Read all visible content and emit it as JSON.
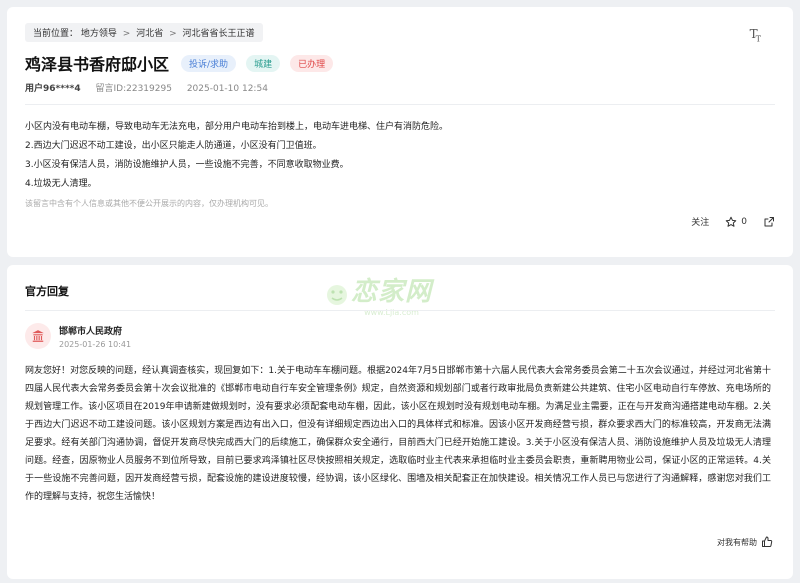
{
  "breadcrumb": {
    "prefix": "当前位置：",
    "items": [
      "地方领导",
      "河北省",
      "河北省省长王正谱"
    ],
    "separator": ">"
  },
  "font_size_control": {
    "label": "T",
    "sub": "T"
  },
  "post": {
    "title": "鸡泽县书香府邸小区",
    "tags": {
      "type": "投诉/求助",
      "domain": "城建",
      "status": "已办理"
    },
    "user": "用户96****4",
    "message_id": "留言ID:22319295",
    "date": "2025-01-10 12:54",
    "body": [
      "小区内没有电动车棚，导致电动车无法充电，部分用户电动车抬到楼上，电动车进电梯、住户有消防危险。",
      "2.西边大门迟迟不动工建设，出小区只能走人防通道，小区没有门卫值班。",
      "3.小区没有保洁人员，消防设施维护人员，一些设施不完善，不同意收取物业费。",
      "4.垃圾无人清理。"
    ],
    "disclaimer": "该留言中含有个人信息或其他不便公开展示的内容，仅办理机构可见。",
    "actions": {
      "follow": "关注",
      "favorites": "0"
    }
  },
  "watermark": {
    "text": "恋家网",
    "sub": "www.Ljia.com"
  },
  "reply": {
    "section_title": "官方回复",
    "org_name": "邯郸市人民政府",
    "org_time": "2025-01-26 10:41",
    "text": "网友您好！对您反映的问题，经认真调查核实，现回复如下：1.关于电动车车棚问题。根据2024年7月5日邯郸市第十六届人民代表大会常务委员会第二十五次会议通过，并经过河北省第十四届人民代表大会常务委员会第十次会议批准的《邯郸市电动自行车安全管理条例》规定，自然资源和规划部门或者行政审批局负责新建公共建筑、住宅小区电动自行车停放、充电场所的规划管理工作。该小区项目在2019年申请新建做规划时，没有要求必须配套电动车棚，因此，该小区在规划时没有规划电动车棚。为满足业主需要，正在与开发商沟通搭建电动车棚。2.关于西边大门迟迟不动工建设问题。该小区规划方案是西边有出入口，但没有详细规定西边出入口的具体样式和标准。因该小区开发商经营亏损，群众要求西大门的标准较高，开发商无法满足要求。经有关部门沟通协调，督促开发商尽快完成西大门的后续施工，确保群众安全通行，目前西大门已经开始施工建设。3.关于小区没有保洁人员、消防设施维护人员及垃圾无人清理问题。经查，因原物业人员服务不到位所导致，目前已要求鸡泽镇社区尽快按照相关规定，选取临时业主代表来承担临时业主委员会职责，重新聘用物业公司，保证小区的正常运转。4.关于一些设施不完善问题，因开发商经营亏损，配套设施的建设进度较慢，经协调，该小区绿化、围墙及相关配套正在加快建设。相关情况工作人员已与您进行了沟通解释，感谢您对我们工作的理解与支持，祝您生活愉快！",
    "helpful_label": "对我有帮助"
  },
  "colors": {
    "page_bg": "#eef0f3",
    "tag_type": "#4a7fd6",
    "tag_domain": "#2a9d8f",
    "tag_status": "#e04848",
    "gov_icon": "#e05a5a"
  },
  "icons": [
    "font-size-icon",
    "star-icon",
    "share-icon",
    "government-building-icon",
    "thumbs-up-icon"
  ]
}
